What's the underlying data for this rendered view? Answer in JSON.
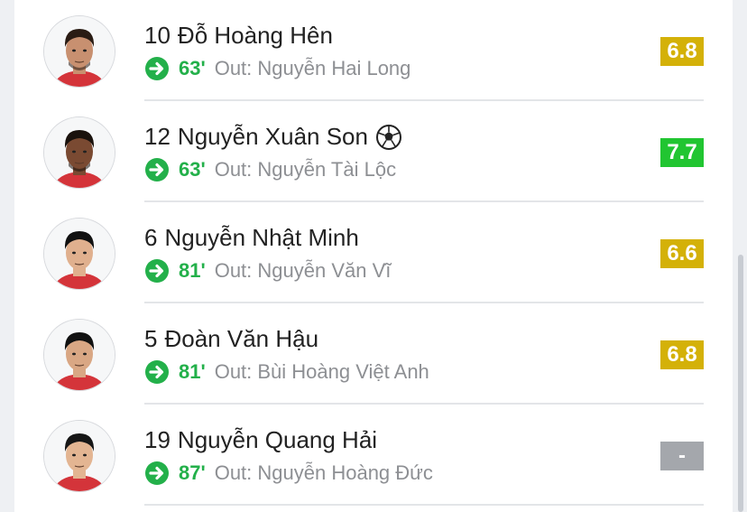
{
  "players": [
    {
      "number": "10",
      "name": "Đỗ Hoàng Hên",
      "scored_goal": false,
      "sub_minute": "63'",
      "sub_out": "Out: Nguyễn Hai Long",
      "rating": "6.8",
      "rating_color": "#d4b108",
      "skin": "#c89070",
      "hair": "#2a1c14",
      "beard": true
    },
    {
      "number": "12",
      "name": "Nguyễn Xuân Son",
      "scored_goal": true,
      "goal_icon": "soccer-ball-icon",
      "sub_minute": "63'",
      "sub_out": "Out: Nguyễn Tài Lộc",
      "rating": "7.7",
      "rating_color": "#21c531",
      "skin": "#7a4a32",
      "hair": "#1a120d",
      "beard": true
    },
    {
      "number": "6",
      "name": "Nguyễn Nhật Minh",
      "scored_goal": false,
      "sub_minute": "81'",
      "sub_out": "Out: Nguyễn Văn Vĩ",
      "rating": "6.6",
      "rating_color": "#d4b108",
      "skin": "#e0b08e",
      "hair": "#111111",
      "beard": false
    },
    {
      "number": "5",
      "name": "Đoàn Văn Hậu",
      "scored_goal": false,
      "sub_minute": "81'",
      "sub_out": "Out: Bùi Hoàng Việt Anh",
      "rating": "6.8",
      "rating_color": "#d4b108",
      "skin": "#d9a784",
      "hair": "#111111",
      "beard": false
    },
    {
      "number": "19",
      "name": "Nguyễn Quang Hải",
      "scored_goal": false,
      "sub_minute": "87'",
      "sub_out": "Out: Nguyễn Hoàng Đức",
      "rating": "-",
      "rating_color": "#a4a7ac",
      "skin": "#e3b592",
      "hair": "#161616",
      "beard": false
    }
  ],
  "icons": {
    "sub_in": "substitution-in-arrow-icon",
    "goal": "soccer-ball-icon"
  },
  "colors": {
    "sub_green": "#23b04a",
    "jersey_red": "#d4343a"
  }
}
